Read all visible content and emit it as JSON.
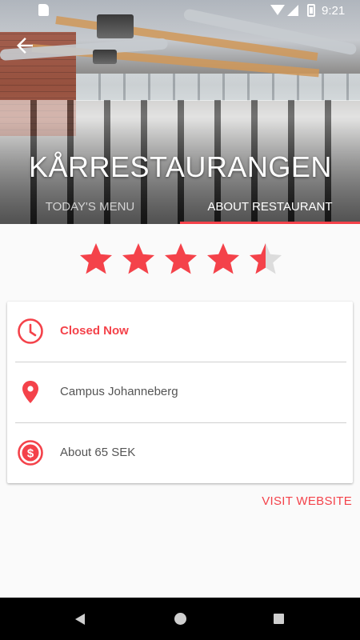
{
  "status_bar": {
    "time": "9:21",
    "icons": [
      "sd-card-icon",
      "wifi-icon",
      "signal-icon",
      "battery-charging-icon"
    ]
  },
  "header": {
    "title": "KÅRRESTAURANGEN",
    "back_icon": "arrow-back-icon",
    "tabs": [
      {
        "label": "TODAY'S MENU",
        "selected": false
      },
      {
        "label": "ABOUT RESTAURANT",
        "selected": true
      }
    ]
  },
  "rating": {
    "value": 4.5,
    "max": 5,
    "star_color": "#f4424a",
    "empty_color": "#dcdcdc"
  },
  "info": {
    "hours": {
      "icon": "clock-icon",
      "text": "Closed Now"
    },
    "location": {
      "icon": "location-pin-icon",
      "text": "Campus Johanneberg"
    },
    "price": {
      "icon": "dollar-icon",
      "text": "About 65 SEK"
    }
  },
  "actions": {
    "visit_website": "VISIT WEBSITE"
  },
  "colors": {
    "accent": "#f4424a",
    "background": "#fafafa",
    "nav_bar": "#000000"
  },
  "nav_bar": {
    "icons": [
      "nav-back-icon",
      "nav-home-icon",
      "nav-recents-icon"
    ]
  }
}
